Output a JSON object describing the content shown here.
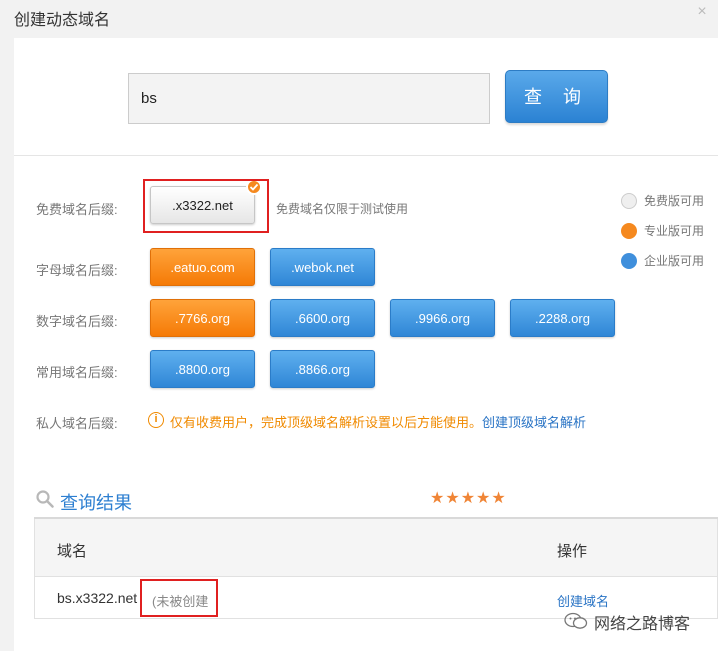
{
  "dialog": {
    "title": "创建动态域名",
    "close_glyph": "×"
  },
  "search": {
    "value": "bs",
    "button_label": "查 询"
  },
  "rows": {
    "free": {
      "label": "免费域名后缀:",
      "suffix": ".x3322.net",
      "note": "免费域名仅限于测试使用"
    },
    "letter": {
      "label": "字母域名后缀:",
      "suffixes": [
        ".eatuo.com",
        ".webok.net"
      ]
    },
    "number": {
      "label": "数字域名后缀:",
      "suffixes": [
        ".7766.org",
        ".6600.org",
        ".9966.org",
        ".2288.org"
      ]
    },
    "common": {
      "label": "常用域名后缀:",
      "suffixes": [
        ".8800.org",
        ".8866.org"
      ]
    },
    "private": {
      "label": "私人域名后缀:",
      "warning": "仅有收费用户，完成顶级域名解析设置以后方能使用。",
      "link": "创建顶级域名解析",
      "icon": "info-icon"
    }
  },
  "legend": [
    {
      "label": "免费版可用",
      "color": "#eeeeee"
    },
    {
      "label": "专业版可用",
      "color": "#f5891f"
    },
    {
      "label": "企业版可用",
      "color": "#3f8fdc"
    }
  ],
  "results": {
    "title": "查询结果",
    "stars": 5,
    "columns": [
      "域名",
      "操作"
    ],
    "rows": [
      {
        "domain": "bs.x3322.net",
        "status": "(未被创建",
        "action": "创建域名"
      }
    ]
  },
  "watermark": {
    "text": "网络之路博客",
    "icon": "wechat-icon"
  },
  "colors": {
    "accent_blue": "#2f86d6",
    "accent_orange": "#f57a06",
    "highlight_red": "#e02020"
  }
}
